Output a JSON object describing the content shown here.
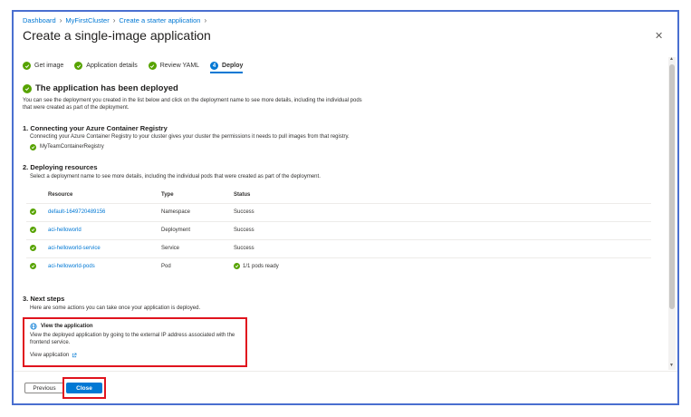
{
  "breadcrumb": [
    "Dashboard",
    "MyFirstCluster",
    "Create a starter application"
  ],
  "title": "Create a single-image application",
  "title_more": "···",
  "close_glyph": "✕",
  "steps": [
    {
      "label": "Get image",
      "state": "done"
    },
    {
      "label": "Application details",
      "state": "done"
    },
    {
      "label": "Review YAML",
      "state": "done"
    },
    {
      "label": "Deploy",
      "state": "active",
      "number": "4"
    }
  ],
  "deployed": {
    "heading": "The application has been deployed",
    "description": "You can see the deployment you created in the list below and click on the deployment name to see more details, including the individual pods that were created as part of the deployment."
  },
  "section1": {
    "heading": "1. Connecting your Azure Container Registry",
    "description": "Connecting your Azure Container Registry to your cluster gives your cluster the permissions it needs to pull images from that registry.",
    "registry": "MyTeamContainerRegistry"
  },
  "section2": {
    "heading": "2. Deploying resources",
    "description": "Select a deployment name to see more details, including the individual pods that were created as part of the deployment.",
    "columns": [
      "Resource",
      "Type",
      "Status"
    ],
    "rows": [
      {
        "resource": "default-1649720489156",
        "type": "Namespace",
        "status": "Success"
      },
      {
        "resource": "aci-helloworld",
        "type": "Deployment",
        "status": "Success"
      },
      {
        "resource": "aci-helloworld-service",
        "type": "Service",
        "status": "Success"
      },
      {
        "resource": "aci-helloworld-pods",
        "type": "Pod",
        "status": "1/1 pods ready"
      }
    ]
  },
  "section3": {
    "heading": "3. Next steps",
    "description": "Here are some actions you can take once your application is deployed.",
    "card_title": "View the application",
    "card_text": "View the deployed application by going to the external IP address associated with the frontend service.",
    "card_link": "View application"
  },
  "footer": {
    "previous": "Previous",
    "close": "Close"
  },
  "colors": {
    "accent": "#0078d4",
    "success": "#57a300",
    "highlight": "#e0141e"
  }
}
